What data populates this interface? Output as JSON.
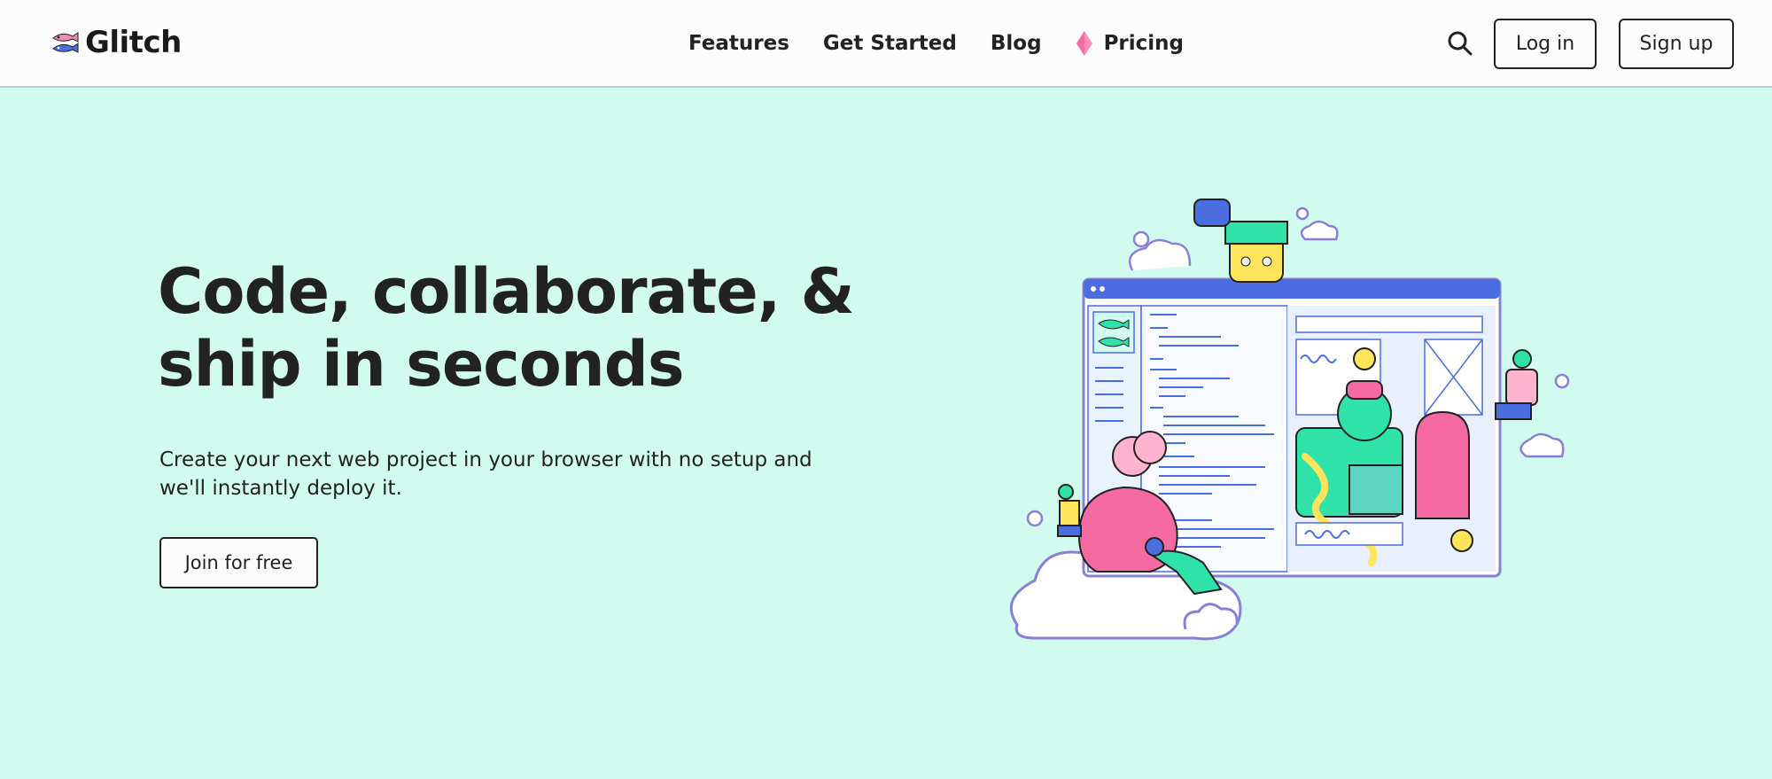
{
  "brand": {
    "name": "Glitch"
  },
  "nav": {
    "items": [
      {
        "label": "Features"
      },
      {
        "label": "Get Started"
      },
      {
        "label": "Blog"
      },
      {
        "label": "Pricing"
      }
    ]
  },
  "actions": {
    "login_label": "Log in",
    "signup_label": "Sign up"
  },
  "hero": {
    "title_line1": "Code, collaborate, &",
    "title_line2": "ship in seconds",
    "subtitle_line1": "Create your next web project in your browser with no setup and",
    "subtitle_line2": "we'll instantly deploy it.",
    "cta_label": "Join for free"
  },
  "colors": {
    "background": "#d2fbef",
    "header": "#fcfcfd",
    "text": "#222222",
    "accent_pink": "#ff7eb3",
    "accent_blue": "#4a6ee0"
  },
  "icons": {
    "search": "search-icon",
    "pricing_gem": "gem-icon",
    "logo": "fish-logo-icon"
  }
}
